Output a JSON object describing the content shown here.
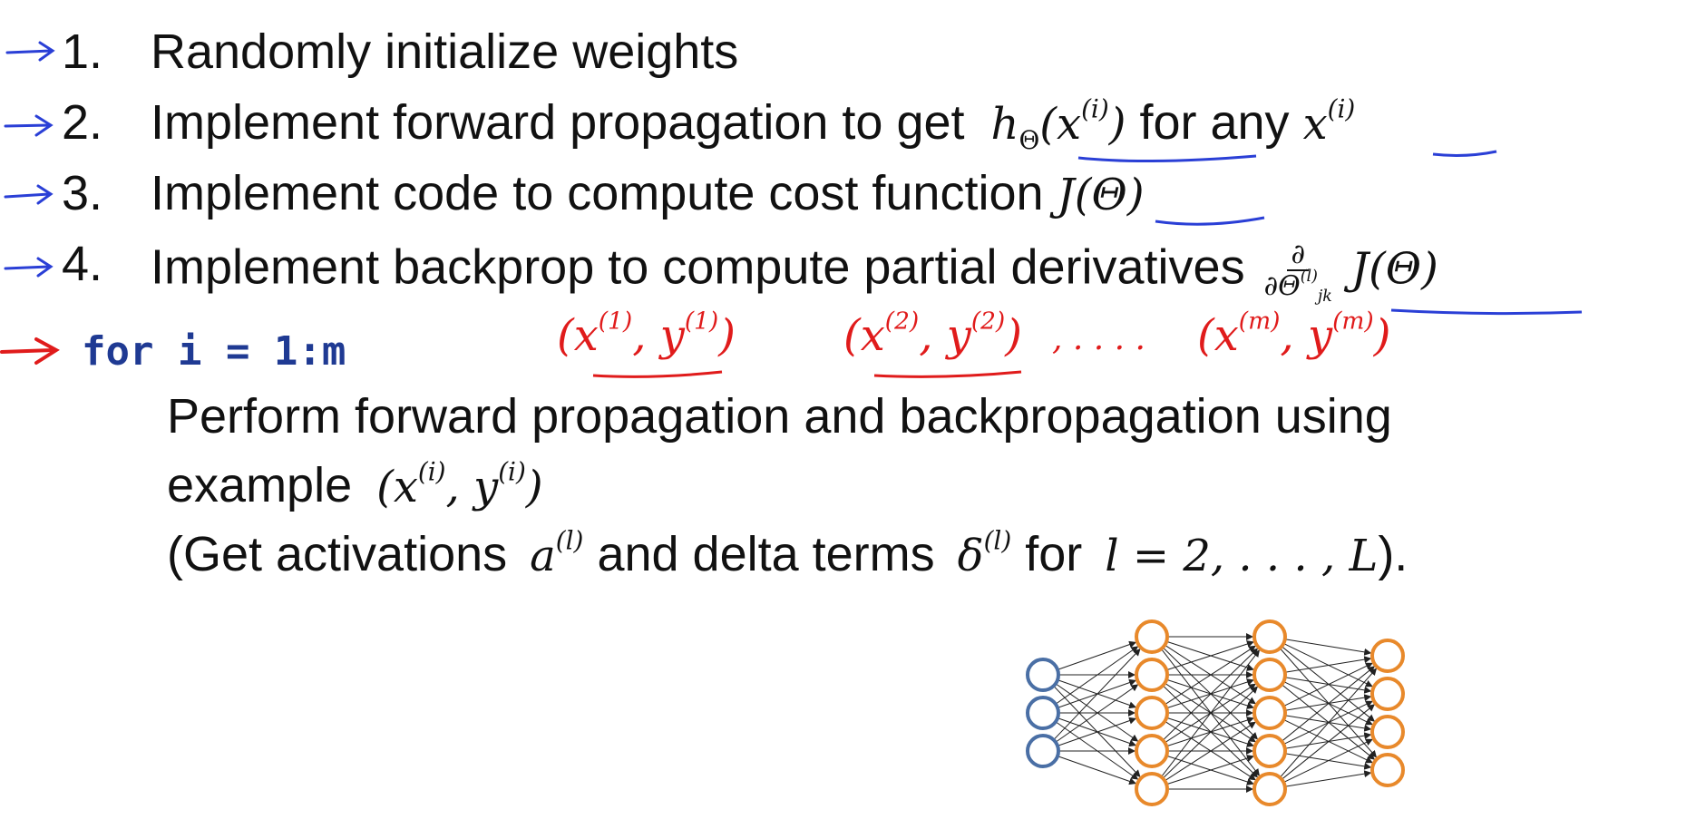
{
  "steps": [
    {
      "number": "1.",
      "text": "Randomly initialize weights"
    },
    {
      "number": "2.",
      "text_before": "Implement forward propagation to get",
      "math_h": "h",
      "math_h_sub": "Θ",
      "math_arg": "(x",
      "math_arg_sup": "(i)",
      "math_close": ")",
      "text_middle": "for any",
      "math_x": "x",
      "math_x_sup": "(i)"
    },
    {
      "number": "3.",
      "text_before": "Implement code to compute cost function",
      "math": "J(Θ)"
    },
    {
      "number": "4.",
      "text_before": "Implement backprop to compute partial derivatives",
      "frac_num": "∂",
      "frac_den": "∂Θ",
      "frac_den_sup": "(l)",
      "frac_den_sub": "jk",
      "math_after": "J(Θ)"
    }
  ],
  "loop": {
    "code": "for i = 1:m"
  },
  "handwritten": {
    "pair1": "(x",
    "pair1_sup1": "(1)",
    "pair1_mid": ", y",
    "pair1_sup2": "(1)",
    "pair1_end": ")",
    "pair2": "(x",
    "pair2_sup1": "(2)",
    "pair2_mid": ", y",
    "pair2_sup2": "(2)",
    "pair2_end": ")",
    "ellipsis": ", . . . .",
    "pair3": "(x",
    "pair3_sup1": "(m)",
    "pair3_mid": ", y",
    "pair3_sup2": "(m)",
    "pair3_end": ")"
  },
  "body": {
    "line1": "Perform forward propagation and backpropagation using",
    "line2_text": "example",
    "line2_math": "(x",
    "line2_sup1": "(i)",
    "line2_mid": ", y",
    "line2_sup2": "(i)",
    "line2_end": ")",
    "line3_a": "(Get activations",
    "line3_math1": "a",
    "line3_sup1": "(l)",
    "line3_b": "and delta terms",
    "line3_math2": "δ",
    "line3_sup2": "(l)",
    "line3_c": "for",
    "line3_math3": "l = 2, . . . , L",
    "line3_d": ")."
  },
  "network": {
    "layer_sizes": [
      3,
      5,
      5,
      4
    ],
    "input_color": "#4a6fa5",
    "hidden_color": "#e8892b",
    "output_color": "#e8892b",
    "edge_color": "#222222"
  },
  "colors": {
    "blue_arrow": "#2a3fd6",
    "red_ink": "#e01b1b",
    "underline_blue": "#2a3fd6"
  }
}
